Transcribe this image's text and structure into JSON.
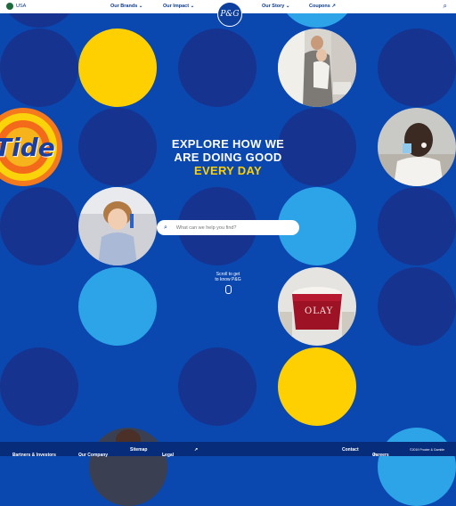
{
  "header": {
    "locale": "USA",
    "nav": [
      {
        "label": "Our Brands",
        "caret": "⌄"
      },
      {
        "label": "Our Impact",
        "caret": "⌄"
      },
      {
        "label": "Our Story",
        "caret": "⌄"
      },
      {
        "label": "Coupons",
        "caret": "↗"
      }
    ],
    "logo": "P&G",
    "search_icon": "⌕"
  },
  "hero": {
    "line1": "EXPLORE HOW WE",
    "line2": "ARE DOING GOOD",
    "line3": "EVERY DAY",
    "search_placeholder": "What can we help you find?",
    "search_icon": "⌕",
    "scroll_line1": "Scroll to get",
    "scroll_line2": "to know P&G"
  },
  "brand_tiles": {
    "tide": "Tide",
    "olay": "OLAY"
  },
  "footer": {
    "links": [
      {
        "label": "Partners & Investors",
        "caret": "⌄"
      },
      {
        "label": "Our Company",
        "caret": "⌄"
      },
      {
        "label": "Sitemap",
        "caret": ""
      },
      {
        "label": "Legal",
        "caret": "⌄"
      },
      {
        "label": "",
        "caret": "↗"
      },
      {
        "label": "Contact",
        "caret": ""
      },
      {
        "label": "Careers",
        "caret": "↗"
      }
    ],
    "copyright": "©2019 Procter & Gamble"
  },
  "colors": {
    "background": "#0a48b0",
    "navy_dot": "#16338f",
    "yellow_dot": "#fed002",
    "light_blue_dot": "#2ea4e8",
    "headline_accent": "#fed002"
  }
}
